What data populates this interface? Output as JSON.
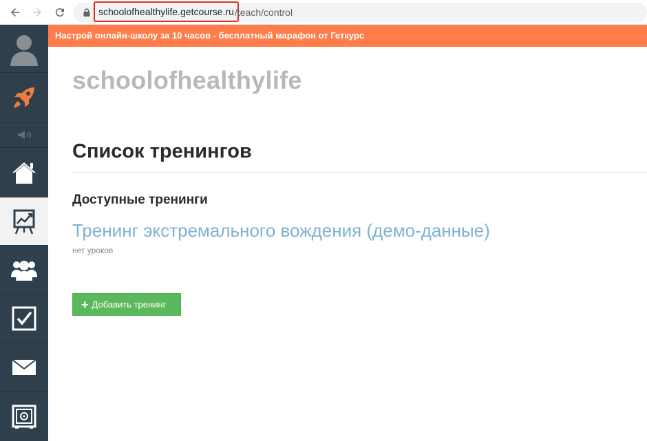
{
  "browser": {
    "url_host": "schoolofhealthylife.getcourse.ru",
    "url_path": "/teach/control",
    "icons": [
      "back-icon",
      "forward-icon",
      "reload-icon",
      "lock-icon"
    ]
  },
  "banner": {
    "text": "Настрой онлайн-школу за 10 часов - бесплатный марафон от Геткурс",
    "color": "#ff7d4b"
  },
  "sidebar": {
    "background": "#2f3f4c",
    "items": [
      {
        "icon": "user-avatar-icon"
      },
      {
        "icon": "rocket-icon"
      },
      {
        "icon": "speaker-icon"
      },
      {
        "icon": "home-icon"
      },
      {
        "icon": "chart-board-icon",
        "active": true
      },
      {
        "icon": "users-icon"
      },
      {
        "icon": "checkbox-icon"
      },
      {
        "icon": "mail-icon"
      },
      {
        "icon": "safe-icon"
      }
    ]
  },
  "main": {
    "school_name": "schoolofhealthylife",
    "page_title": "Список тренингов",
    "section_title": "Доступные тренинги",
    "trainings": [
      {
        "title": "Тренинг экстремального вождения (демо-данные)",
        "meta": "нет уроков"
      }
    ],
    "add_button_label": "Добавить тренинг",
    "add_button_icon": "plus-icon"
  }
}
